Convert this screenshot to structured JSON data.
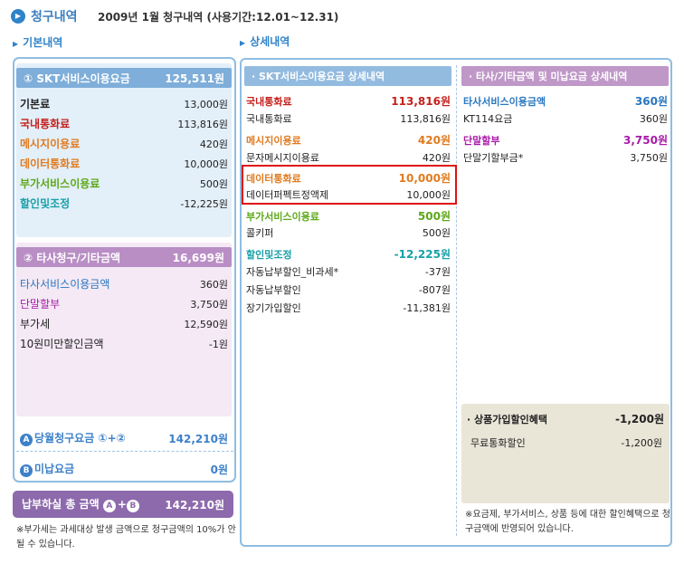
{
  "header": {
    "icon": "play-circle-icon",
    "title": "청구내역",
    "subtitle": "2009년 1월 청구내역 (사용기간:12.01~12.31)"
  },
  "basic": {
    "section_label": "기본내역",
    "skt": {
      "label": "① SKT서비스이용요금",
      "amount": "125,511원",
      "items": [
        {
          "label": "기본료",
          "amount": "13,000원",
          "color": "#222222"
        },
        {
          "label": "국내통화료",
          "amount": "113,816원",
          "color": "#c4211d"
        },
        {
          "label": "메시지이용료",
          "amount": "420원",
          "color": "#e07b1f"
        },
        {
          "label": "데이터통화료",
          "amount": "10,000원",
          "color": "#e07b1f"
        },
        {
          "label": "부가서비스이용료",
          "amount": "500원",
          "color": "#5da818"
        },
        {
          "label": "할인및조정",
          "amount": "-12,225원",
          "color": "#18a0a8"
        }
      ]
    },
    "other": {
      "label": "② 타사청구/기타금액",
      "amount": "16,699원",
      "items": [
        {
          "label": "타사서비스이용금액",
          "amount": "360원",
          "color": "#2a77bf"
        },
        {
          "label": "단말할부",
          "amount": "3,750원",
          "color": "#a81aa8"
        },
        {
          "label": "부가세",
          "amount": "12,590원",
          "color": "#222222"
        },
        {
          "label": "10원미만할인금액",
          "amount": "-1원",
          "color": "#222222"
        }
      ]
    },
    "monthly": {
      "letter": "A",
      "label": "당월청구요금 ①+②",
      "amount": "142,210원"
    },
    "unpaid": {
      "letter": "B",
      "label": "미납요금",
      "amount": "0원"
    },
    "total": {
      "label": "납부하실 총 금액",
      "letter_a": "A",
      "plus": "+",
      "letter_b": "B",
      "amount": "142,210원"
    },
    "note": "※부가세는 과세대상 발생 금액으로 청구금액의 10%가 안될 수 있습니다."
  },
  "detail": {
    "section_label": "상세내역",
    "skt": {
      "label": "· SKT서비스이용요금 상세내역",
      "groups": [
        {
          "label": "국내통화료",
          "amount": "113,816원",
          "color": "#c4211d",
          "items": [
            {
              "label": "국내통화료",
              "amount": "113,816원"
            }
          ]
        },
        {
          "label": "메시지이용료",
          "amount": "420원",
          "color": "#e07b1f",
          "items": [
            {
              "label": "문자메시지이용료",
              "amount": "420원"
            }
          ]
        },
        {
          "label": "데이터통화료",
          "amount": "10,000원",
          "color": "#e07b1f",
          "items": [
            {
              "label": "데이터퍼펙트정액제",
              "amount": "10,000원"
            }
          ]
        },
        {
          "label": "부가서비스이용료",
          "amount": "500원",
          "color": "#5da818",
          "items": [
            {
              "label": "콜키퍼",
              "amount": "500원"
            }
          ]
        },
        {
          "label": "할인및조정",
          "amount": "-12,225원",
          "color": "#18a0a8",
          "items": [
            {
              "label": "자동납부할인_비과세*",
              "amount": "-37원"
            },
            {
              "label": "자동납부할인",
              "amount": "-807원"
            },
            {
              "label": "장기가입할인",
              "amount": "-11,381원"
            }
          ]
        }
      ]
    },
    "other": {
      "label": "· 타사/기타금액 및 미납요금 상세내역",
      "groups": [
        {
          "label": "타사서비스이용금액",
          "amount": "360원",
          "color": "#2a77bf",
          "items": [
            {
              "label": "KT114요금",
              "amount": "360원"
            }
          ]
        },
        {
          "label": "단말할부",
          "amount": "3,750원",
          "color": "#a81aa8",
          "items": [
            {
              "label": "단말기할부금*",
              "amount": "3,750원"
            }
          ]
        }
      ]
    },
    "benefit": {
      "label": "· 상품가입할인혜택",
      "amount": "-1,200원",
      "items": [
        {
          "label": "무료통화할인",
          "amount": "-1,200원"
        }
      ]
    },
    "note": "※요금제, 부가서비스, 상품 등에 대한 할인혜택으로 청구금액에 반영되어 있습니다."
  }
}
